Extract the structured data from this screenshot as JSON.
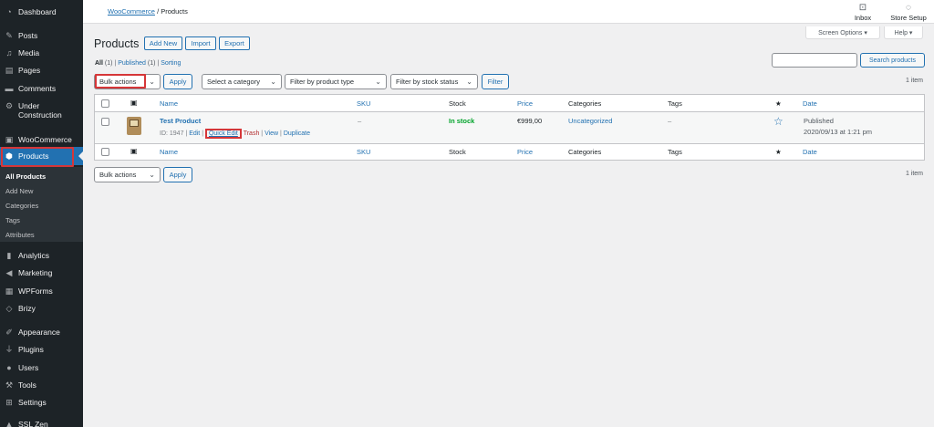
{
  "sidebar": {
    "items": [
      {
        "label": "Dashboard",
        "icon": "dashboard-icon"
      },
      {
        "label": "Posts",
        "icon": "pin-icon"
      },
      {
        "label": "Media",
        "icon": "media-icon"
      },
      {
        "label": "Pages",
        "icon": "pages-icon"
      },
      {
        "label": "Comments",
        "icon": "comments-icon"
      },
      {
        "label": "Under Construction",
        "icon": "gear-icon"
      },
      {
        "label": "WooCommerce",
        "icon": "woocommerce-icon"
      },
      {
        "label": "Products",
        "icon": "box-icon"
      },
      {
        "label": "Analytics",
        "icon": "bar-chart-icon"
      },
      {
        "label": "Marketing",
        "icon": "megaphone-icon"
      },
      {
        "label": "WPForms",
        "icon": "form-icon"
      },
      {
        "label": "Brizy",
        "icon": "brizy-icon"
      },
      {
        "label": "Appearance",
        "icon": "brush-icon"
      },
      {
        "label": "Plugins",
        "icon": "plug-icon"
      },
      {
        "label": "Users",
        "icon": "user-icon"
      },
      {
        "label": "Tools",
        "icon": "wrench-icon"
      },
      {
        "label": "Settings",
        "icon": "settings-icon"
      },
      {
        "label": "SSL Zen",
        "icon": "lock-icon"
      }
    ],
    "submenu": [
      "All Products",
      "Add New",
      "Categories",
      "Tags",
      "Attributes"
    ]
  },
  "header": {
    "breadcrumb_link": "WooCommerce",
    "breadcrumb_sep": "/",
    "breadcrumb_current": "Products",
    "inbox_label": "Inbox",
    "store_setup_label": "Store Setup",
    "screen_options": "Screen Options ▾",
    "help": "Help ▾"
  },
  "page": {
    "title": "Products",
    "add_new": "Add New",
    "import": "Import",
    "export": "Export"
  },
  "views": {
    "all": "All",
    "all_count": "(1)",
    "sep1": "|",
    "published": "Published",
    "published_count": "(1)",
    "sep2": "|",
    "sorting": "Sorting"
  },
  "search": {
    "button": "Search products",
    "value": ""
  },
  "filters": {
    "bulk_actions": "Bulk actions",
    "apply": "Apply",
    "category": "Select a category",
    "product_type": "Filter by product type",
    "stock_status": "Filter by stock status",
    "filter": "Filter",
    "items_count": "1 item"
  },
  "table": {
    "columns": {
      "name": "Name",
      "sku": "SKU",
      "stock": "Stock",
      "price": "Price",
      "categories": "Categories",
      "tags": "Tags",
      "featured": "★",
      "date": "Date"
    },
    "row": {
      "name": "Test Product",
      "id_label": "ID: 1947",
      "edit": "Edit",
      "quick_edit": "Quick Edit",
      "trash": "Trash",
      "view": "View",
      "duplicate": "Duplicate",
      "sku": "–",
      "stock": "In stock",
      "price": "€999,00",
      "category": "Uncategorized",
      "tags": "–",
      "featured_icon": "☆",
      "date_status": "Published",
      "date_value": "2020/09/13 at 1:21 pm"
    }
  },
  "colors": {
    "sidebar_bg": "#1d2327",
    "accent": "#2271b1",
    "in_stock": "#00a32a",
    "highlight": "#d63638"
  }
}
